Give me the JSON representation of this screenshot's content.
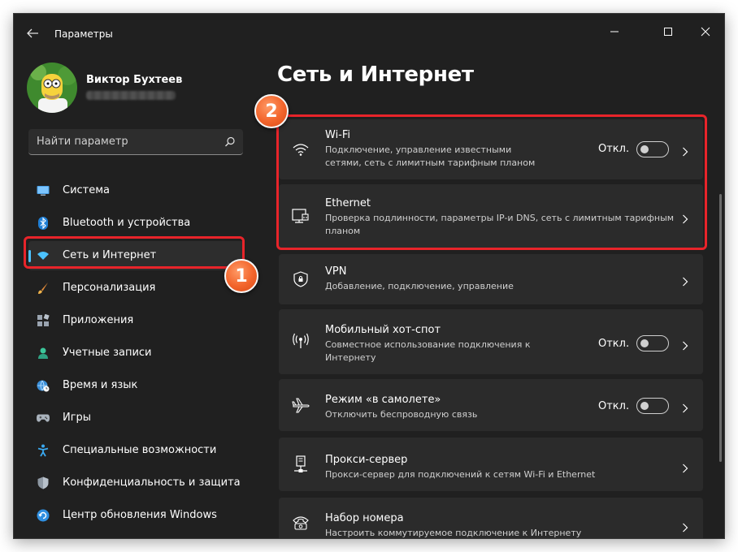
{
  "window": {
    "title": "Параметры"
  },
  "user": {
    "name": "Виктор Бухтеев"
  },
  "search": {
    "placeholder": "Найти параметр"
  },
  "nav": {
    "items": [
      {
        "label": "Система",
        "icon": "monitor-icon"
      },
      {
        "label": "Bluetooth и устройства",
        "icon": "bluetooth-icon"
      },
      {
        "label": "Сеть и Интернет",
        "icon": "wifi-icon",
        "active": true
      },
      {
        "label": "Персонализация",
        "icon": "brush-icon"
      },
      {
        "label": "Приложения",
        "icon": "apps-icon"
      },
      {
        "label": "Учетные записи",
        "icon": "person-icon"
      },
      {
        "label": "Время и язык",
        "icon": "globe-clock-icon"
      },
      {
        "label": "Игры",
        "icon": "gamepad-icon"
      },
      {
        "label": "Специальные возможности",
        "icon": "accessibility-icon"
      },
      {
        "label": "Конфиденциальность и защита",
        "icon": "shield-icon"
      },
      {
        "label": "Центр обновления Windows",
        "icon": "update-icon"
      }
    ]
  },
  "main": {
    "title": "Сеть и Интернет",
    "cards": [
      {
        "title": "Wi-Fi",
        "desc": "Подключение, управление известными сетями, сеть с лимитным тарифным планом",
        "status": "Откл.",
        "toggle_on": false,
        "icon": "wifi-icon"
      },
      {
        "title": "Ethernet",
        "desc": "Проверка подлинности, параметры IP-и DNS, сеть с лимитным тарифным планом",
        "icon": "ethernet-icon"
      },
      {
        "title": "VPN",
        "desc": "Добавление, подключение, управление",
        "icon": "vpn-shield-icon"
      },
      {
        "title": "Мобильный хот-спот",
        "desc": "Совместное использование подключения к Интернету",
        "status": "Откл.",
        "toggle_on": false,
        "icon": "hotspot-icon"
      },
      {
        "title": "Режим «в самолете»",
        "desc": "Отключить беспроводную связь",
        "status": "Откл.",
        "toggle_on": false,
        "icon": "airplane-icon"
      },
      {
        "title": "Прокси-сервер",
        "desc": "Прокси-сервер для подключений к сетям Wi-Fi и Ethernet",
        "icon": "proxy-icon"
      },
      {
        "title": "Набор номера",
        "desc": "Настроить коммутируемое подключение к Интернету",
        "icon": "dialup-icon"
      }
    ]
  },
  "annotations": {
    "badge1": "1",
    "badge2": "2",
    "highlight_color": "#e8242a",
    "badge_color": "#f2642b"
  },
  "colors": {
    "accent": "#4cc2ff",
    "background": "#202020",
    "card": "#2b2b2b"
  }
}
